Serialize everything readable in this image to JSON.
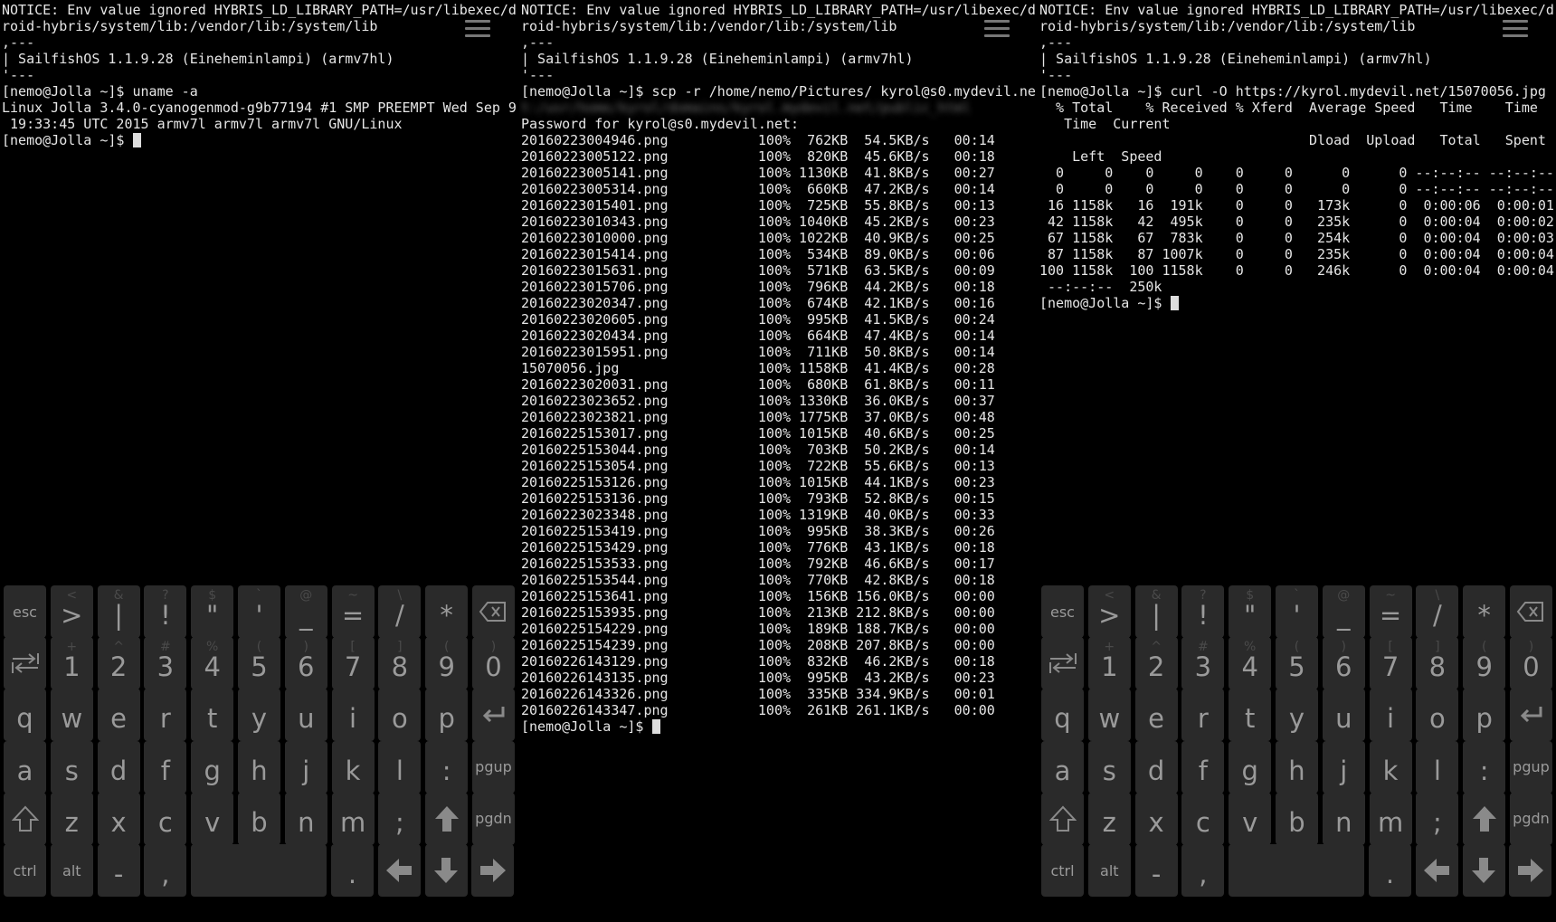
{
  "terminals": [
    {
      "lines": [
        "NOTICE: Env value ignored HYBRIS_LD_LIBRARY_PATH=/usr/libexec/d",
        "roid-hybris/system/lib:/vendor/lib:/system/lib",
        ",---",
        "| SailfishOS 1.1.9.28 (Eineheminlampi) (armv7hl)",
        "'---",
        "[nemo@Jolla ~]$ uname -a",
        "Linux Jolla 3.4.0-cyanogenmod-g9b77194 #1 SMP PREEMPT Wed Sep 9",
        " 19:33:45 UTC 2015 armv7l armv7l armv7l GNU/Linux",
        "[nemo@Jolla ~]$ "
      ]
    },
    {
      "lines": [
        "NOTICE: Env value ignored HYBRIS_LD_LIBRARY_PATH=/usr/libexec/d",
        "roid-hybris/system/lib:/vendor/lib:/system/lib",
        ",---",
        "| SailfishOS 1.1.9.28 (Eineheminlampi) (armv7hl)",
        "'---",
        "[nemo@Jolla ~]$ scp -r /home/nemo/Pictures/ kyrol@s0.mydevil.ne",
        "t:/usr/home/kyrol/domains/kyrol.mydevil.net/public_html",
        "Password for kyrol@s0.mydevil.net:",
        "20160223004946.png           100%  762KB  54.5KB/s   00:14",
        "20160223005122.png           100%  820KB  45.6KB/s   00:18",
        "20160223005141.png           100% 1130KB  41.8KB/s   00:27",
        "20160223005314.png           100%  660KB  47.2KB/s   00:14",
        "20160223015401.png           100%  725KB  55.8KB/s   00:13",
        "20160223010343.png           100% 1040KB  45.2KB/s   00:23",
        "20160223010000.png           100% 1022KB  40.9KB/s   00:25",
        "20160223015414.png           100%  534KB  89.0KB/s   00:06",
        "20160223015631.png           100%  571KB  63.5KB/s   00:09",
        "20160223015706.png           100%  796KB  44.2KB/s   00:18",
        "20160223020347.png           100%  674KB  42.1KB/s   00:16",
        "20160223020605.png           100%  995KB  41.5KB/s   00:24",
        "20160223020434.png           100%  664KB  47.4KB/s   00:14",
        "20160223015951.png           100%  711KB  50.8KB/s   00:14",
        "15070056.jpg                 100% 1158KB  41.4KB/s   00:28",
        "20160223020031.png           100%  680KB  61.8KB/s   00:11",
        "20160223023652.png           100% 1330KB  36.0KB/s   00:37",
        "20160223023821.png           100% 1775KB  37.0KB/s   00:48",
        "20160225153017.png           100% 1015KB  40.6KB/s   00:25",
        "20160225153044.png           100%  703KB  50.2KB/s   00:14",
        "20160225153054.png           100%  722KB  55.6KB/s   00:13",
        "20160225153126.png           100% 1015KB  44.1KB/s   00:23",
        "20160225153136.png           100%  793KB  52.8KB/s   00:15",
        "20160223023348.png           100% 1319KB  40.0KB/s   00:33",
        "20160225153419.png           100%  995KB  38.3KB/s   00:26",
        "20160225153429.png           100%  776KB  43.1KB/s   00:18",
        "20160225153533.png           100%  792KB  46.6KB/s   00:17",
        "20160225153544.png           100%  770KB  42.8KB/s   00:18",
        "20160225153641.png           100%  156KB 156.0KB/s   00:00",
        "20160225153935.png           100%  213KB 212.8KB/s   00:00",
        "20160225154229.png           100%  189KB 188.7KB/s   00:00",
        "20160225154239.png           100%  208KB 207.8KB/s   00:00",
        "20160226143129.png           100%  832KB  46.2KB/s   00:18",
        "20160226143135.png           100%  995KB  43.2KB/s   00:23",
        "20160226143326.png           100%  335KB 334.9KB/s   00:01",
        "20160226143347.png           100%  261KB 261.1KB/s   00:00",
        "[nemo@Jolla ~]$ "
      ]
    },
    {
      "lines": [
        "NOTICE: Env value ignored HYBRIS_LD_LIBRARY_PATH=/usr/libexec/d",
        "roid-hybris/system/lib:/vendor/lib:/system/lib",
        ",---",
        "| SailfishOS 1.1.9.28 (Eineheminlampi) (armv7hl)",
        "'---",
        "[nemo@Jolla ~]$ curl -O https://kyrol.mydevil.net/15070056.jpg",
        "  % Total    % Received % Xferd  Average Speed   Time    Time",
        "   Time  Current",
        "                                 Dload  Upload   Total   Spent",
        "    Left  Speed",
        "  0     0    0     0    0     0      0      0 --:--:-- --:--:--",
        "  0     0    0     0    0     0      0      0 --:--:-- --:--:--",
        " 16 1158k   16  191k    0     0   173k      0  0:00:06  0:00:01",
        " 42 1158k   42  495k    0     0   235k      0  0:00:04  0:00:02",
        " 67 1158k   67  783k    0     0   254k      0  0:00:04  0:00:03",
        " 87 1158k   87 1007k    0     0   235k      0  0:00:04  0:00:04",
        "100 1158k  100 1158k    0     0   246k      0  0:00:04  0:00:04",
        " --:--:--  250k",
        "[nemo@Jolla ~]$ "
      ]
    }
  ],
  "keyboard": {
    "rows": [
      [
        {
          "main": "esc",
          "alt": "",
          "type": "small"
        },
        {
          "main": ">",
          "alt": "<"
        },
        {
          "main": "|",
          "alt": "&"
        },
        {
          "main": "!",
          "alt": "?"
        },
        {
          "main": "\"",
          "alt": "$"
        },
        {
          "main": "'",
          "alt": "`"
        },
        {
          "main": "_",
          "alt": "@"
        },
        {
          "main": "=",
          "alt": "~"
        },
        {
          "main": "/",
          "alt": "\\"
        },
        {
          "main": "*",
          "alt": ""
        },
        {
          "main": "",
          "alt": "",
          "icon": "backspace-icon"
        }
      ],
      [
        {
          "main": "",
          "alt": "",
          "icon": "tab-icon"
        },
        {
          "main": "1",
          "alt": "+"
        },
        {
          "main": "2",
          "alt": "^"
        },
        {
          "main": "3",
          "alt": "#"
        },
        {
          "main": "4",
          "alt": "%"
        },
        {
          "main": "5",
          "alt": "("
        },
        {
          "main": "6",
          "alt": ")"
        },
        {
          "main": "7",
          "alt": "["
        },
        {
          "main": "8",
          "alt": "]"
        },
        {
          "main": "9",
          "alt": "("
        },
        {
          "main": "0",
          "alt": ")"
        }
      ],
      [
        {
          "main": "q",
          "alt": ""
        },
        {
          "main": "w",
          "alt": ""
        },
        {
          "main": "e",
          "alt": ""
        },
        {
          "main": "r",
          "alt": ""
        },
        {
          "main": "t",
          "alt": ""
        },
        {
          "main": "y",
          "alt": ""
        },
        {
          "main": "u",
          "alt": ""
        },
        {
          "main": "i",
          "alt": ""
        },
        {
          "main": "o",
          "alt": ""
        },
        {
          "main": "p",
          "alt": ""
        },
        {
          "main": "",
          "alt": "",
          "icon": "enter-icon"
        }
      ],
      [
        {
          "main": "a",
          "alt": ""
        },
        {
          "main": "s",
          "alt": ""
        },
        {
          "main": "d",
          "alt": ""
        },
        {
          "main": "f",
          "alt": ""
        },
        {
          "main": "g",
          "alt": ""
        },
        {
          "main": "h",
          "alt": ""
        },
        {
          "main": "j",
          "alt": ""
        },
        {
          "main": "k",
          "alt": ""
        },
        {
          "main": "l",
          "alt": ""
        },
        {
          "main": ":",
          "alt": ""
        },
        {
          "main": "pgup",
          "alt": "",
          "type": "small"
        }
      ],
      [
        {
          "main": "",
          "alt": "",
          "icon": "shift-icon"
        },
        {
          "main": "z",
          "alt": ""
        },
        {
          "main": "x",
          "alt": ""
        },
        {
          "main": "c",
          "alt": ""
        },
        {
          "main": "v",
          "alt": ""
        },
        {
          "main": "b",
          "alt": ""
        },
        {
          "main": "n",
          "alt": ""
        },
        {
          "main": "m",
          "alt": ""
        },
        {
          "main": ";",
          "alt": ""
        },
        {
          "main": "",
          "alt": "",
          "icon": "arrow-up-icon"
        },
        {
          "main": "pgdn",
          "alt": "",
          "type": "small"
        }
      ],
      [
        {
          "main": "ctrl",
          "alt": "",
          "type": "small"
        },
        {
          "main": "alt",
          "alt": "",
          "type": "small"
        },
        {
          "main": "-",
          "alt": ""
        },
        {
          "main": ",",
          "alt": ""
        },
        {
          "main": "",
          "alt": "",
          "type": "space"
        },
        {
          "main": ".",
          "alt": ""
        },
        {
          "main": "",
          "alt": "",
          "icon": "arrow-left-icon"
        },
        {
          "main": "",
          "alt": "",
          "icon": "arrow-down-icon"
        },
        {
          "main": "",
          "alt": "",
          "icon": "arrow-right-icon"
        }
      ]
    ]
  }
}
